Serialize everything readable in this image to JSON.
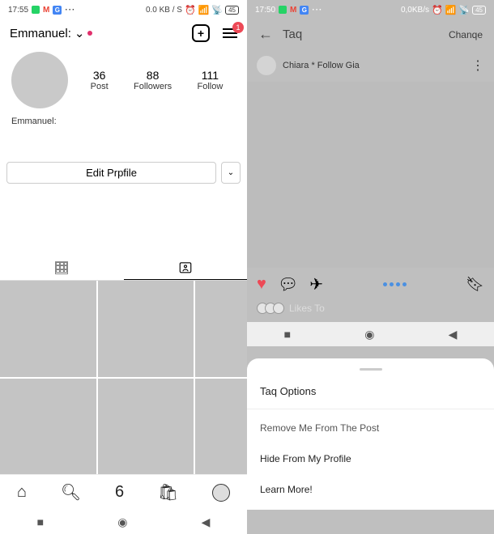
{
  "left": {
    "status": {
      "time": "17:55",
      "data_rate": "0.0 KB / S",
      "battery": "45"
    },
    "header": {
      "username": "Emmanuel:",
      "badge": "1"
    },
    "profile": {
      "posts_num": "36",
      "posts_label": "Post",
      "followers_num": "88",
      "followers_label": "Followers",
      "following_num": "111",
      "following_label": "Follow",
      "display_name": "Emmanuel:"
    },
    "edit_label": "Edit Prpfile",
    "reels_label": "6"
  },
  "right": {
    "status": {
      "time": "17:50",
      "data_rate": "0,0KB/s",
      "battery": "45"
    },
    "header": {
      "title": "Taq",
      "action": "Chanqe"
    },
    "post_user": "Chiara * Follow Gia",
    "likes_text": "Likes To",
    "sheet": {
      "title": "Taq Options",
      "item1": "Remove Me From The Post",
      "item2": "Hide From My Profile",
      "item3": "Learn More!"
    }
  }
}
